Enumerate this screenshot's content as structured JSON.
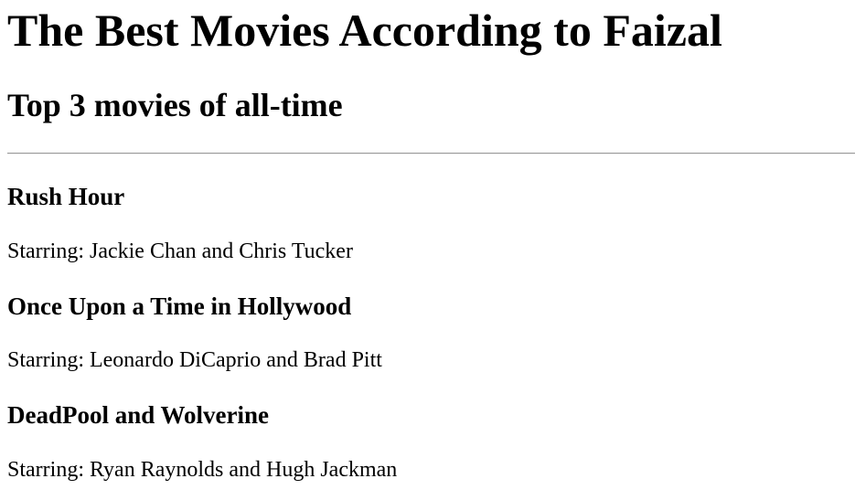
{
  "page": {
    "heading": "The Best Movies According to Faizal",
    "subheading": "Top 3 movies of all-time"
  },
  "movies": [
    {
      "title": "Rush Hour",
      "starring": "Starring: Jackie Chan and Chris Tucker"
    },
    {
      "title": "Once Upon a Time in Hollywood",
      "starring": "Starring: Leonardo DiCaprio and Brad Pitt"
    },
    {
      "title": "DeadPool and Wolverine",
      "starring": "Starring: Ryan Raynolds and Hugh Jackman"
    }
  ]
}
